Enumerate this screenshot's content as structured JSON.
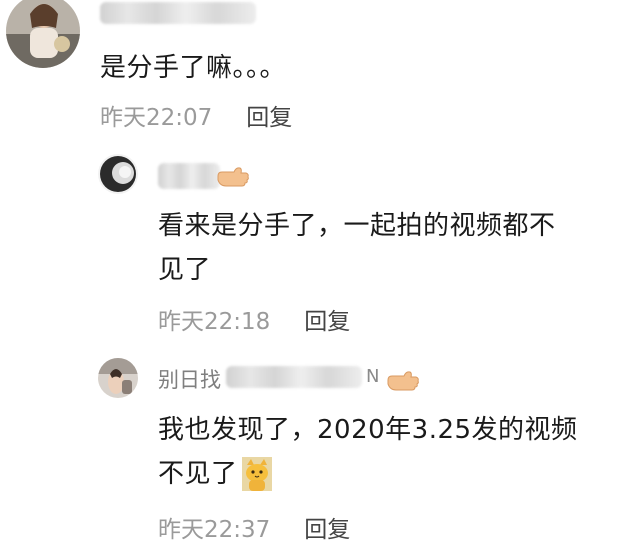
{
  "comments": [
    {
      "text": "是分手了嘛。。。",
      "time": "昨天22:07",
      "reply_label": "回复"
    },
    {
      "text_line1": "看来是分手了，一起拍的视频都不",
      "text_line2": "见了",
      "time": "昨天22:18",
      "reply_label": "回复"
    },
    {
      "username_visible": "别日找",
      "username_tail": "N",
      "text_line1": "我也发现了，2020年3.25发的视频",
      "text_line2": "不见了",
      "time": "昨天22:37",
      "reply_label": "回复"
    }
  ],
  "colors": {
    "text": "#1a1a1a",
    "meta": "#9a9a9a",
    "reply": "#444444",
    "hand": "#f5c49a"
  },
  "icons": [
    "pointing-hand-icon",
    "cat-emoji-icon"
  ]
}
